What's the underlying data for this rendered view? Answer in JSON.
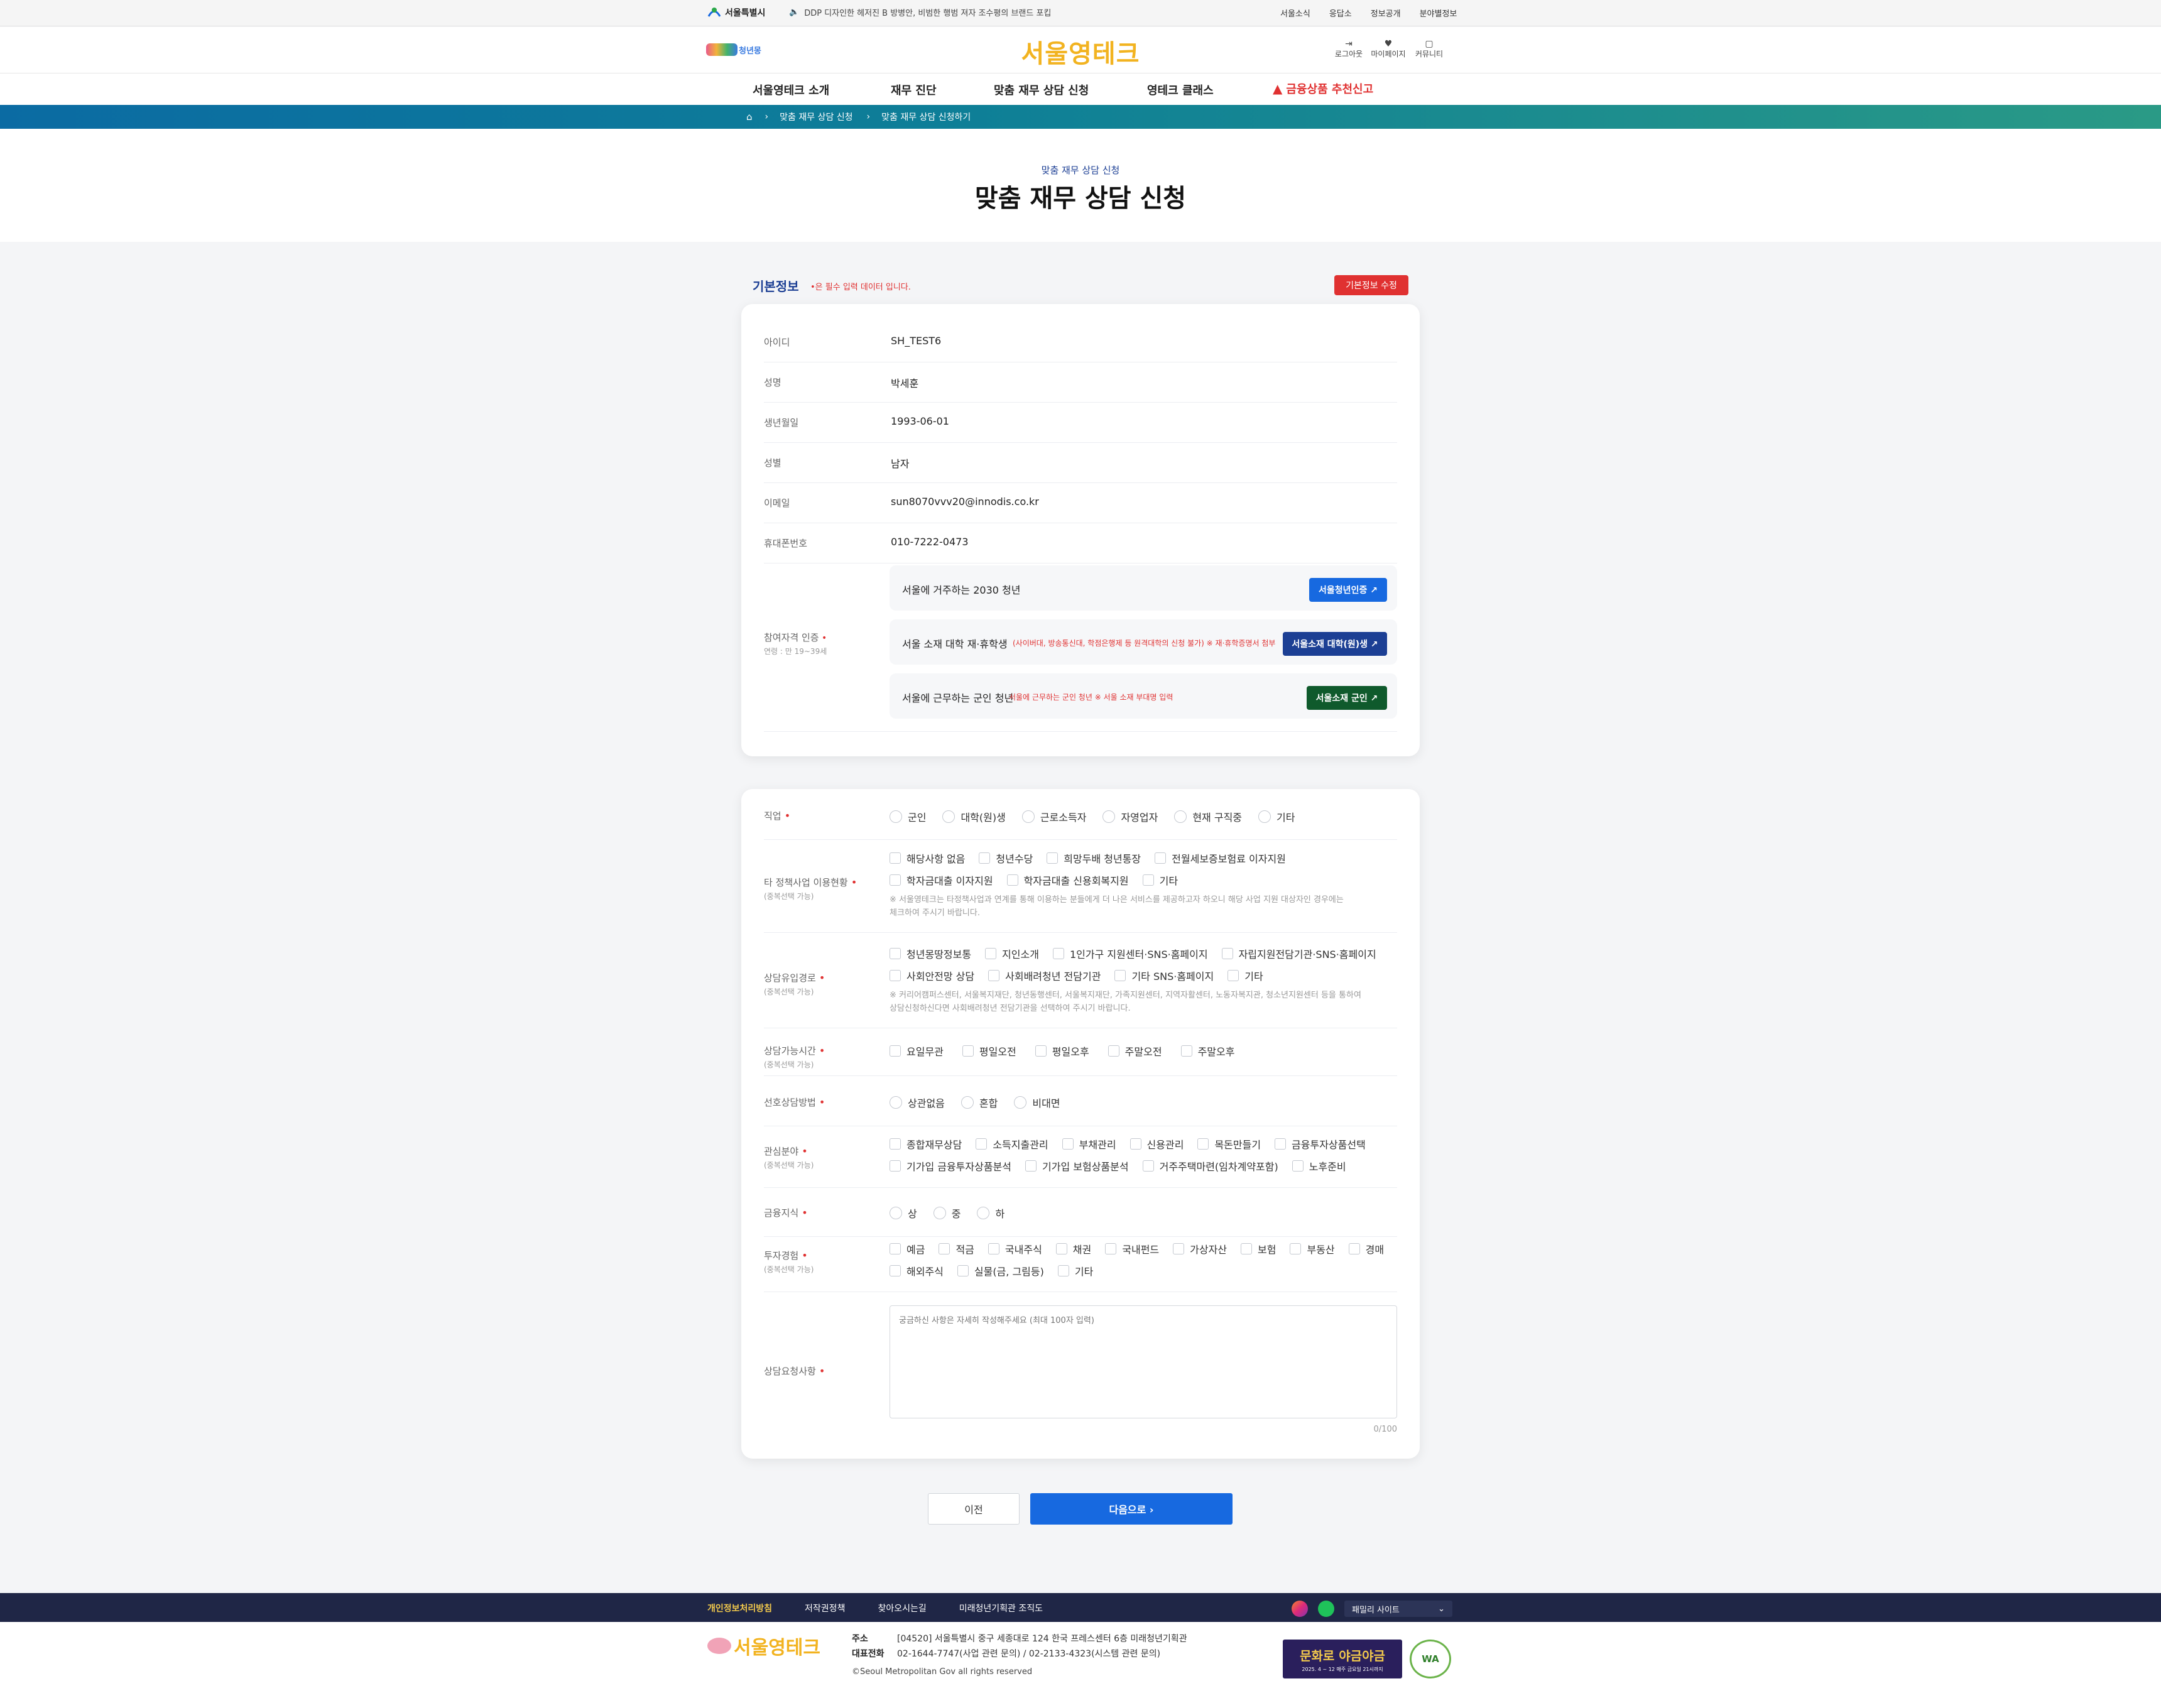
{
  "topbar": {
    "seoul_logo": "서울특별시",
    "notice": "DDP 디자인한 헤저진 B 방병안, 비범한 행범 져자 조수평의 브랜드 포킵",
    "links": [
      "서울소식",
      "응답소",
      "정보공개",
      "분야별정보"
    ]
  },
  "header": {
    "left_logo": "청년몽",
    "brand": "서울영테크",
    "util": {
      "logout": "로그아웃",
      "mypage": "마이페이지",
      "community": "커뮤니티"
    }
  },
  "gnb": {
    "items": [
      "서울영테크 소개",
      "재무 진단",
      "맞춤 재무 상담 신청",
      "영테크 클래스"
    ],
    "alert": "금융상품 추천신고"
  },
  "breadcrumb": {
    "level1": "맞춤 재무 상담 신청",
    "level2": "맞춤 재무 상담 신청하기"
  },
  "page": {
    "subtitle": "맞춤 재무 상담 신청",
    "title": "맞춤 재무 상담 신청"
  },
  "basic": {
    "heading": "기본정보",
    "required_note": "•은 필수 입력 데이터 입니다.",
    "edit_button": "기본정보 수정",
    "fields": [
      {
        "label": "아이디",
        "value": "SH_TEST6"
      },
      {
        "label": "성명",
        "value": "박세훈"
      },
      {
        "label": "생년월일",
        "value": "1993-06-01"
      },
      {
        "label": "성별",
        "value": "남자"
      },
      {
        "label": "이메일",
        "value": "sun8070vvv20@innodis.co.kr"
      },
      {
        "label": "휴대폰번호",
        "value": "010-7222-0473"
      }
    ],
    "qual_label": "참여자격 인증",
    "qual_sub": "연령 : 만 19~39세",
    "qual": [
      {
        "text": "서울에 거주하는 2030 청년",
        "note": "",
        "button": "서울청년인증 ↗"
      },
      {
        "text": "서울 소재 대학 재·휴학생",
        "note": "(사이버대, 방송통신대, 학점은행제 등 원격대학의 신청 불가) ※ 재·휴학증명서 첨부",
        "button": "서울소재 대학(원)생 ↗"
      },
      {
        "text": "서울에 근무하는 군인 청년",
        "note": "서울에 근무하는 군인 청년 ※ 서울 소재 부대명 입력",
        "button": "서울소재 군인 ↗"
      }
    ]
  },
  "survey": {
    "job": {
      "label": "직업",
      "options": [
        "군인",
        "대학(원)생",
        "근로소득자",
        "자영업자",
        "현재 구직중",
        "기타"
      ]
    },
    "policy": {
      "label": "타 정책사업 이용현황",
      "sub": "(중복선택 가능)",
      "row1": [
        "해당사항 없음",
        "청년수당",
        "희망두배 청년통장",
        "전월세보증보험료 이자지원"
      ],
      "row2": [
        "학자금대출 이자지원",
        "학자금대출 신용회복지원",
        "기타"
      ],
      "note1": "※ 서울영테크는 타정책사업과 연계를 통해 이용하는 분들에게 더 나은 서비스를 제공하고자 하오니 해당 사업 지원 대상자인 경우에는",
      "note2": "체크하여 주시기 바랍니다."
    },
    "route": {
      "label": "상담유입경로",
      "sub": "(중복선택 가능)",
      "row1": [
        "청년몽땅정보통",
        "지인소개",
        "1인가구 지원센터·SNS·홈페이지",
        "자립지원전담기관·SNS·홈페이지"
      ],
      "row2": [
        "사회안전망 상담",
        "사회배려청년 전담기관",
        "기타 SNS·홈페이지",
        "기타"
      ],
      "note1": "※ 커리어캠퍼스센터, 서울복지재단, 청년동행센터, 서울복지재단, 가족지원센터, 지역자활센터, 노동자복지관, 청소년지원센터 등을 통하여",
      "note2": "상담신청하신다면 사회배려청년 전담기관을 선택하여 주시기 바랍니다."
    },
    "time": {
      "label": "상담가능시간",
      "sub": "(중복선택 가능)",
      "options": [
        "요일무관",
        "평일오전",
        "평일오후",
        "주말오전",
        "주말오후"
      ]
    },
    "method": {
      "label": "선호상담방법",
      "options": [
        "상관없음",
        "혼합",
        "비대면"
      ]
    },
    "interest": {
      "label": "관심분야",
      "sub": "(중복선택 가능)",
      "row1": [
        "종합재무상담",
        "소득지출관리",
        "부채관리",
        "신용관리",
        "목돈만들기",
        "금융투자상품선택"
      ],
      "row2": [
        "기가입 금융투자상품분석",
        "기가입 보험상품분석",
        "거주주택마련(임차계약포함)",
        "노후준비"
      ]
    },
    "knowledge": {
      "label": "금융지식",
      "options": [
        "상",
        "중",
        "하"
      ]
    },
    "invest": {
      "label": "투자경험",
      "sub": "(중복선택 가능)",
      "row1": [
        "예금",
        "적금",
        "국내주식",
        "채권",
        "국내펀드",
        "가상자산",
        "보험",
        "부동산",
        "경매"
      ],
      "row2": [
        "해외주식",
        "실물(금, 그림등)",
        "기타"
      ]
    },
    "request": {
      "label": "상담요청사항",
      "placeholder": "궁금하신 사항은 자세히 작성해주세요 (최대 100자 입력)",
      "counter": "0/100"
    }
  },
  "buttons": {
    "prev": "이전",
    "next": "다음으로 ›"
  },
  "footer": {
    "links": [
      "개인정보처리방침",
      "저작권정책",
      "찾아오시는길",
      "미래청년기획관 조직도"
    ],
    "family": "패밀리 사이트",
    "brand": "서울영테크",
    "addr_label": "주소",
    "addr": "[04520] 서울특별시 중구 세종대로 124 한국 프레스센터 6층 미래청년기획관",
    "tel_label": "대표전화",
    "tel": "02-1644-7747(사업 관련 문의) / 02-2133-4323(시스템 관련 문의)",
    "copyright": "©Seoul Metropolitan Gov all rights reserved",
    "banner_title": "문화로 야금야금",
    "banner_sub": "2025. 4 ~ 12 매주 금요일 21시까지",
    "wa_mark": "WA"
  },
  "colors": {
    "blue": "#1769e0",
    "navy": "#1c3f94",
    "green": "#0f5a2c",
    "red": "#e03131",
    "footer_bg": "#1f2646"
  }
}
